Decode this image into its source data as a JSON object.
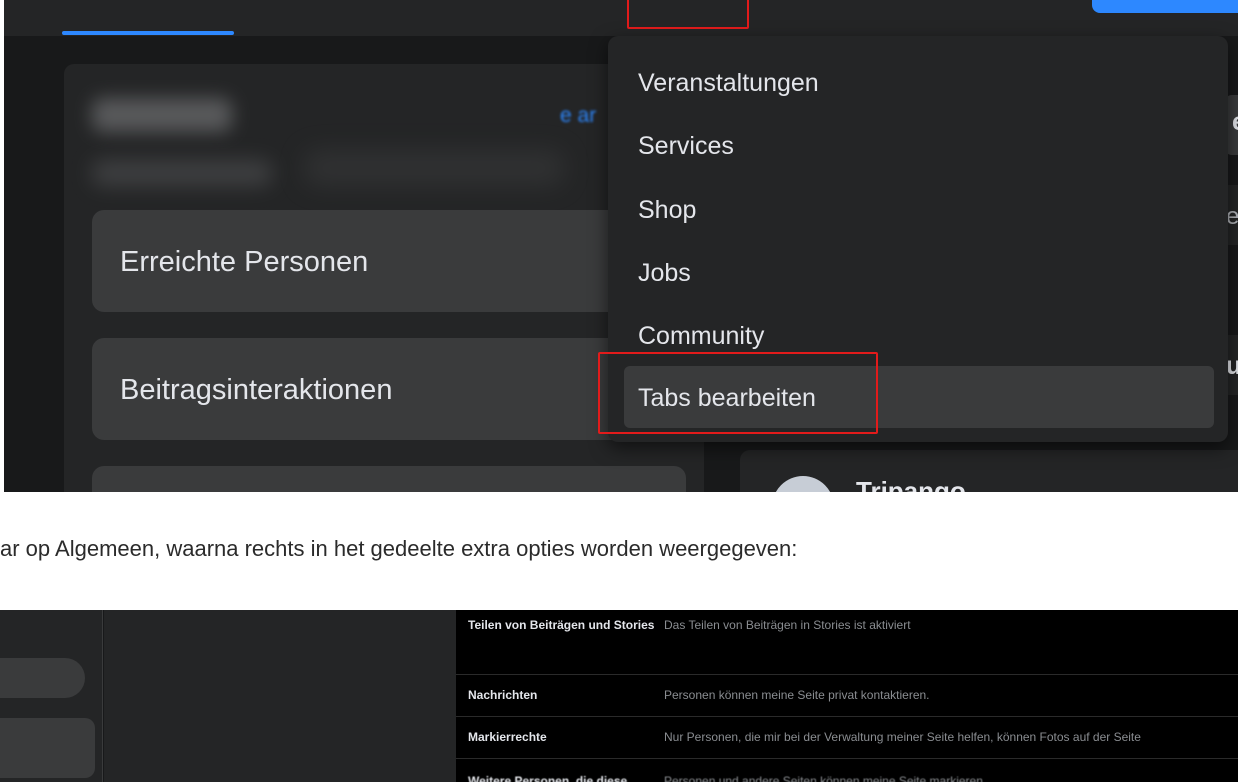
{
  "top_screenshot": {
    "left_panel": {
      "see_all_fragment": "e ar",
      "metrics": [
        "Erreichte Personen",
        "Beitragsinteraktionen"
      ]
    },
    "dropdown_menu": {
      "items": [
        "Veranstaltungen",
        "Services",
        "Shop",
        "Jobs",
        "Community",
        "Tabs bearbeiten"
      ],
      "highlighted_item": "Tabs bearbeiten"
    },
    "right_panel": {
      "page_name_partial": "Tripango",
      "edge_fragments": [
        "e",
        "e",
        "u"
      ]
    },
    "colors": {
      "background": "#18191a",
      "card": "#242526",
      "hover": "#3a3b3c",
      "accent": "#2d88ff",
      "highlight_box": "#e21b1b",
      "text": "#e4e6eb"
    }
  },
  "caption": "ar op Algemeen, waarna rechts in het gedeelte extra opties worden weergegeven:",
  "bottom_screenshot": {
    "settings_rows": [
      {
        "label": "Teilen von Beiträgen und Stories",
        "value": "Das Teilen von Beiträgen in Stories ist aktiviert"
      },
      {
        "label": "Nachrichten",
        "value": "Personen können meine Seite privat kontaktieren."
      },
      {
        "label": "Markierrechte",
        "value": "Nur Personen, die mir bei der Verwaltung meiner Seite helfen, können Fotos auf der Seite"
      },
      {
        "label": "Weitere Personen, die diese",
        "value": "Personen und andere Seiten können meine Seite markieren."
      }
    ]
  }
}
